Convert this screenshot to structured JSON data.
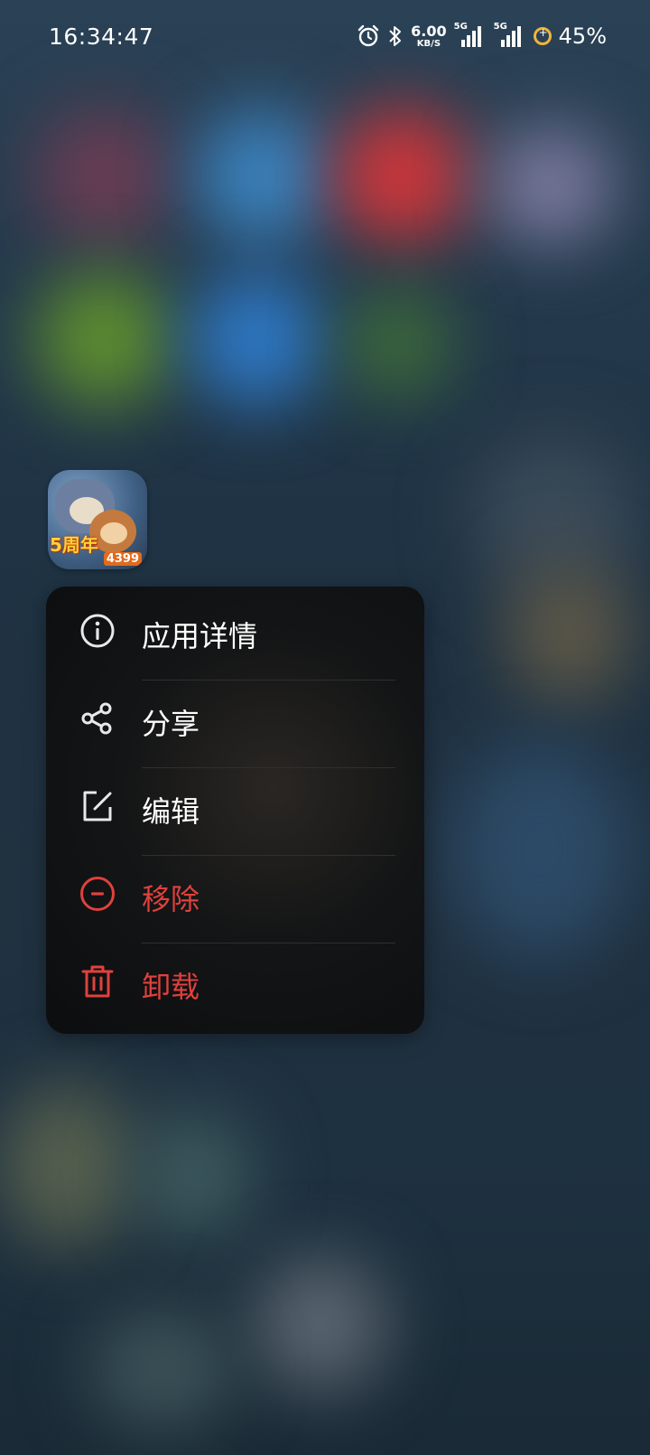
{
  "status_bar": {
    "time": "16:34:47",
    "net_speed_value": "6.00",
    "net_speed_unit": "KB/S",
    "signal_1_label": "5G",
    "signal_2_label": "5G",
    "battery": "45%",
    "icons": [
      "alarm-icon",
      "bluetooth-icon",
      "signal-icon",
      "signal-icon",
      "battery-charging-icon"
    ]
  },
  "app": {
    "icon_badge": "5周年",
    "icon_brand": "4399"
  },
  "menu": {
    "items": [
      {
        "label": "应用详情",
        "icon": "info-icon",
        "color": "#ffffff"
      },
      {
        "label": "分享",
        "icon": "share-icon",
        "color": "#ffffff"
      },
      {
        "label": "编辑",
        "icon": "edit-icon",
        "color": "#ffffff"
      },
      {
        "label": "移除",
        "icon": "remove-icon",
        "color": "#e0413d"
      },
      {
        "label": "卸载",
        "icon": "trash-icon",
        "color": "#e0413d"
      }
    ]
  },
  "colors": {
    "danger": "#e0413d",
    "menu_bg": "#0c0d0f",
    "battery_ring": "#f1b43b"
  }
}
